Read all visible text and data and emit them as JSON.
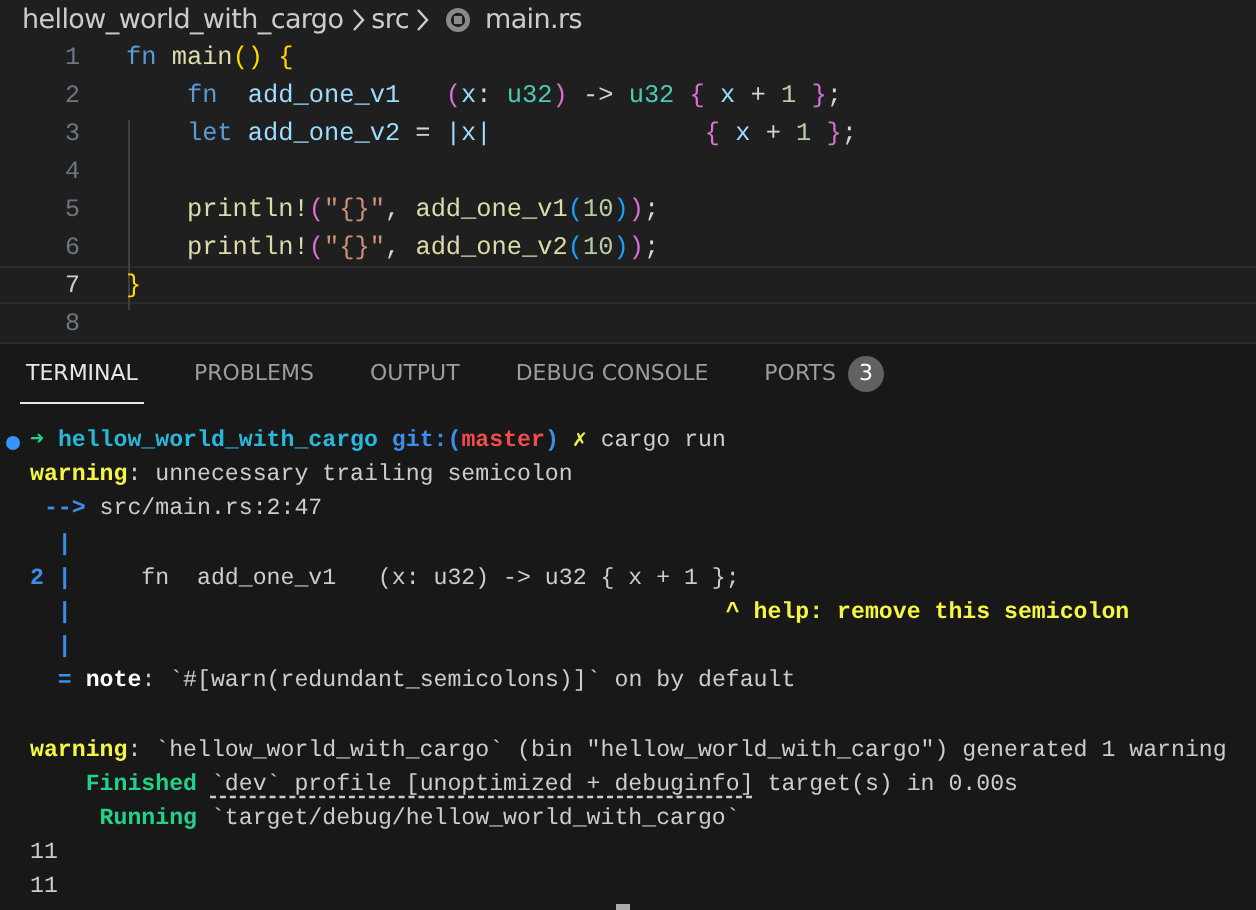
{
  "breadcrumb": {
    "folder": "hellow_world_with_cargo",
    "subfolder": "src",
    "file": "main.rs"
  },
  "editor": {
    "lines": [
      {
        "number": "1",
        "active": false,
        "tokens": [
          {
            "kind": "kw",
            "text": "fn "
          },
          {
            "kind": "fn",
            "text": "main"
          },
          {
            "kind": "b1",
            "text": "() {"
          }
        ]
      },
      {
        "number": "2",
        "active": false,
        "tokens": [
          {
            "kind": "kw",
            "text": "    fn  "
          },
          {
            "kind": "var",
            "text": "add_one_v1   "
          },
          {
            "kind": "b2",
            "text": "("
          },
          {
            "kind": "var",
            "text": "x"
          },
          {
            "kind": "op",
            "text": ": "
          },
          {
            "kind": "type",
            "text": "u32"
          },
          {
            "kind": "b2",
            "text": ")"
          },
          {
            "kind": "op",
            "text": " -> "
          },
          {
            "kind": "type",
            "text": "u32 "
          },
          {
            "kind": "b2",
            "text": "{ "
          },
          {
            "kind": "var",
            "text": "x"
          },
          {
            "kind": "op",
            "text": " + "
          },
          {
            "kind": "num",
            "text": "1"
          },
          {
            "kind": "b2",
            "text": " }"
          },
          {
            "kind": "op",
            "text": ";"
          }
        ]
      },
      {
        "number": "3",
        "active": false,
        "tokens": [
          {
            "kind": "kw",
            "text": "    let "
          },
          {
            "kind": "var",
            "text": "add_one_v2"
          },
          {
            "kind": "op",
            "text": " = "
          },
          {
            "kind": "var",
            "text": "|x|              "
          },
          {
            "kind": "b2",
            "text": "{ "
          },
          {
            "kind": "var",
            "text": "x"
          },
          {
            "kind": "op",
            "text": " + "
          },
          {
            "kind": "num",
            "text": "1"
          },
          {
            "kind": "b2",
            "text": " }"
          },
          {
            "kind": "op",
            "text": ";"
          }
        ]
      },
      {
        "number": "4",
        "active": false
      },
      {
        "number": "5",
        "active": false,
        "tokens": [
          {
            "kind": "fn",
            "text": "    println!"
          },
          {
            "kind": "b2",
            "text": "("
          },
          {
            "kind": "str",
            "text": "\"{}\""
          },
          {
            "kind": "op",
            "text": ", "
          },
          {
            "kind": "fn",
            "text": "add_one_v1"
          },
          {
            "kind": "b3",
            "text": "("
          },
          {
            "kind": "num",
            "text": "10"
          },
          {
            "kind": "b3",
            "text": ")"
          },
          {
            "kind": "b2",
            "text": ")"
          },
          {
            "kind": "op",
            "text": ";"
          }
        ]
      },
      {
        "number": "6",
        "active": false,
        "tokens": [
          {
            "kind": "fn",
            "text": "    println!"
          },
          {
            "kind": "b2",
            "text": "("
          },
          {
            "kind": "str",
            "text": "\"{}\""
          },
          {
            "kind": "op",
            "text": ", "
          },
          {
            "kind": "fn",
            "text": "add_one_v2"
          },
          {
            "kind": "b3",
            "text": "("
          },
          {
            "kind": "num",
            "text": "10"
          },
          {
            "kind": "b3",
            "text": ")"
          },
          {
            "kind": "b2",
            "text": ")"
          },
          {
            "kind": "op",
            "text": ";"
          }
        ]
      },
      {
        "number": "7",
        "active": true,
        "tokens": [
          {
            "kind": "b1",
            "text": "}"
          }
        ]
      },
      {
        "number": "8",
        "active": false
      }
    ]
  },
  "panel": {
    "tabs": [
      {
        "label": "TERMINAL",
        "selected": true
      },
      {
        "label": "PROBLEMS",
        "selected": false
      },
      {
        "label": "OUTPUT",
        "selected": false
      },
      {
        "label": "DEBUG CONSOLE",
        "selected": false
      },
      {
        "label": "PORTS",
        "selected": false,
        "badge": "3"
      }
    ],
    "terminal": {
      "blocks": [
        [
          {
            "kind": "prompt",
            "tokens": [
              {
                "kind": "arrow",
                "text": "➜ "
              },
              {
                "kind": "dir",
                "text": "hellow_world_with_cargo "
              },
              {
                "kind": "git",
                "text": "git:("
              },
              {
                "kind": "branch",
                "text": "master"
              },
              {
                "kind": "git",
                "text": ") "
              },
              {
                "kind": "dirty",
                "text": "✗ "
              },
              {
                "kind": "plain",
                "text": "cargo run"
              }
            ]
          },
          {
            "kind": "output",
            "tokens": [
              {
                "kind": "warn",
                "text": "warning"
              },
              {
                "kind": "plain",
                "text": ": unnecessary trailing semicolon"
              }
            ]
          },
          {
            "kind": "output",
            "tokens": [
              {
                "kind": "gutter",
                "text": " --> "
              },
              {
                "kind": "plain",
                "text": "src/main.rs:2:47"
              }
            ]
          },
          {
            "kind": "output",
            "tokens": [
              {
                "kind": "gutter",
                "text": "  |"
              }
            ]
          },
          {
            "kind": "output",
            "tokens": [
              {
                "kind": "gutter",
                "text": "2 |"
              },
              {
                "kind": "plain",
                "text": "     fn  add_one_v1   (x: u32) -> u32 { x + 1 };"
              }
            ]
          },
          {
            "kind": "output",
            "tokens": [
              {
                "kind": "gutter",
                "text": "  |"
              },
              {
                "kind": "help",
                "text": "                                               ^ help: remove this semicolon"
              }
            ]
          },
          {
            "kind": "output",
            "tokens": [
              {
                "kind": "gutter",
                "text": "  |"
              }
            ]
          },
          {
            "kind": "output",
            "tokens": [
              {
                "kind": "gutter",
                "text": "  = "
              },
              {
                "kind": "note",
                "text": "note"
              },
              {
                "kind": "plain",
                "text": ": `#[warn(redundant_semicolons)]` on by default"
              }
            ]
          }
        ],
        [
          {
            "kind": "output",
            "tokens": [
              {
                "kind": "warn",
                "text": "warning"
              },
              {
                "kind": "plain",
                "text": ": `hellow_world_with_cargo` (bin \"hellow_world_with_cargo\") generated 1 warning"
              }
            ]
          },
          {
            "kind": "output",
            "tokens": [
              {
                "kind": "status",
                "text": "    Finished "
              },
              {
                "kind": "link",
                "text": "`dev` profile [unoptimized + debuginfo]"
              },
              {
                "kind": "plain",
                "text": " target(s) in 0.00s"
              }
            ]
          },
          {
            "kind": "output",
            "tokens": [
              {
                "kind": "status",
                "text": "     Running "
              },
              {
                "kind": "plain",
                "text": "`target/debug/hellow_world_with_cargo`"
              }
            ]
          },
          {
            "kind": "output",
            "tokens": [
              {
                "kind": "plain",
                "text": "11"
              }
            ]
          },
          {
            "kind": "output",
            "tokens": [
              {
                "kind": "plain",
                "text": "11"
              }
            ]
          }
        ]
      ]
    }
  }
}
